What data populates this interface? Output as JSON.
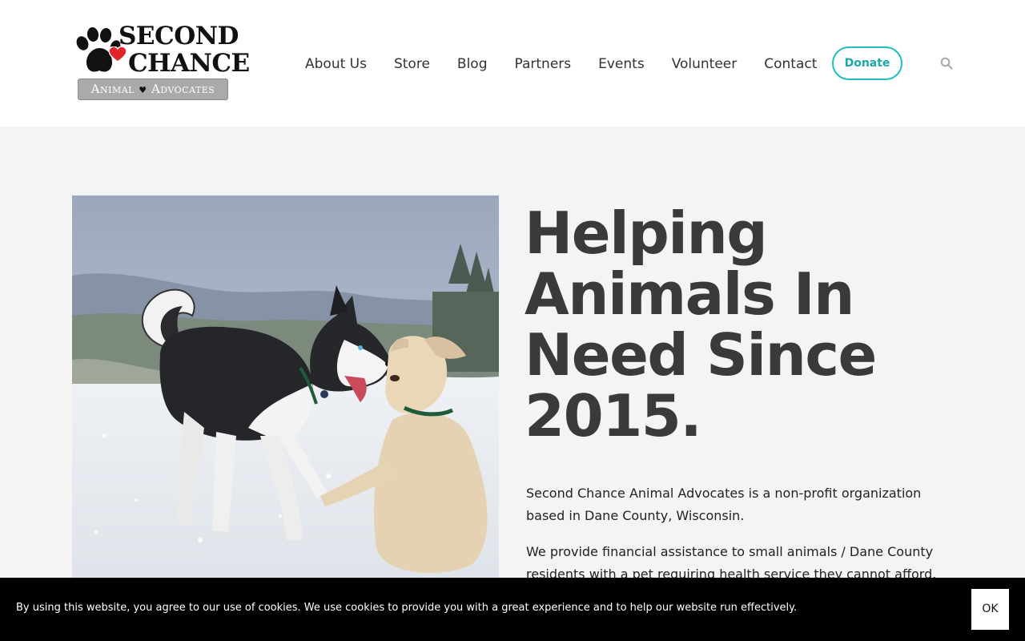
{
  "logo": {
    "line1": "Second",
    "line2": "Chance",
    "subtitle_left": "Animal",
    "subtitle_right": "Advocates"
  },
  "nav": {
    "items": [
      "About Us",
      "Store",
      "Blog",
      "Partners",
      "Events",
      "Volunteer",
      "Contact"
    ]
  },
  "donate_label": "Donate",
  "icons": {
    "search": "search-icon",
    "paw": "paw-icon",
    "heart": "heart-icon"
  },
  "hero": {
    "title_lines": [
      "Helping",
      "Animals In",
      "Need Since",
      "2015."
    ],
    "paragraph1": "Second Chance Animal Advocates is a non-profit organization based in Dane County, Wisconsin.",
    "paragraph2": "We provide financial assistance to small animals / Dane County residents with a pet requiring health service they cannot afford."
  },
  "cookie": {
    "text": "By using this website, you agree to our use of cookies. We use cookies to provide you with a great experience and to help our website run effectively.",
    "ok_label": "OK"
  },
  "colors": {
    "accent": "#1fbec1",
    "heart": "#e2232a",
    "heading": "#3a3a3a",
    "background": "#f4f4f4"
  }
}
